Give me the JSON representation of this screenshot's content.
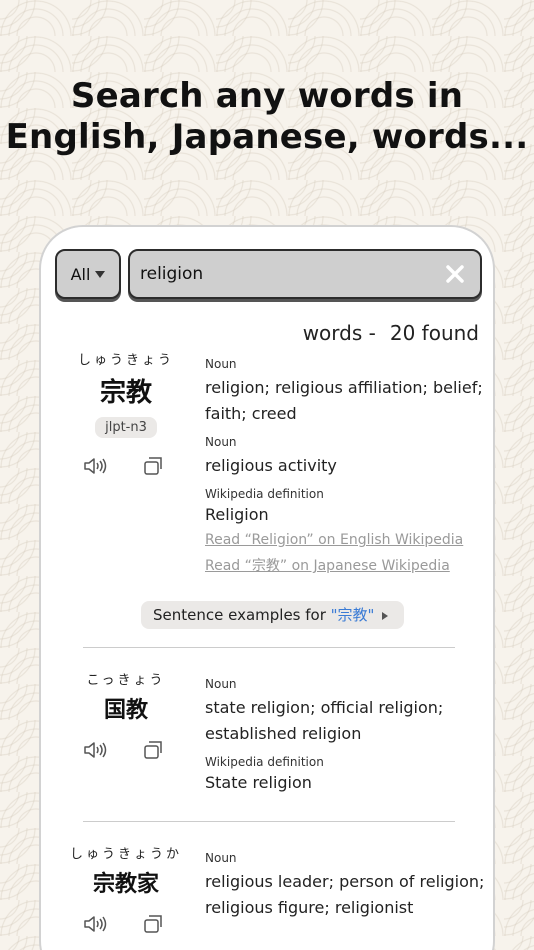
{
  "headline": {
    "line1": "Search any words in",
    "line2": "English, Japanese, words..."
  },
  "search": {
    "filter_label": "All",
    "value": "religion",
    "clear_icon": "close-icon"
  },
  "results": {
    "label": "words -",
    "count": "20 found"
  },
  "entries": [
    {
      "reading": "しゅうきょう",
      "kanji": "宗教",
      "jlpt": "jlpt-n3",
      "senses": [
        {
          "pos": "Noun",
          "gloss": [
            "religion; religious affiliation; belief;",
            "faith; creed"
          ]
        },
        {
          "pos": "Noun",
          "gloss": [
            "religious activity"
          ]
        }
      ],
      "wiki": {
        "label": "Wikipedia definition",
        "title": "Religion",
        "links": [
          "Read “Religion” on English Wikipedia",
          "Read “宗教” on Japanese Wikipedia"
        ]
      },
      "sentence": {
        "prefix": "Sentence examples for ",
        "term": "\"宗教\""
      }
    },
    {
      "reading": "こっきょう",
      "kanji": "国教",
      "senses": [
        {
          "pos": "Noun",
          "gloss": [
            "state religion; official religion;",
            "established religion"
          ]
        }
      ],
      "wiki": {
        "label": "Wikipedia definition",
        "title": "State religion"
      }
    },
    {
      "reading": "しゅうきょうか",
      "kanji": "宗教家",
      "senses": [
        {
          "pos": "Noun",
          "gloss": [
            "religious leader; person of religion;",
            "religious figure; religionist"
          ]
        }
      ]
    }
  ],
  "icons": {
    "speaker": "speaker-icon",
    "copy": "copy-icon"
  }
}
